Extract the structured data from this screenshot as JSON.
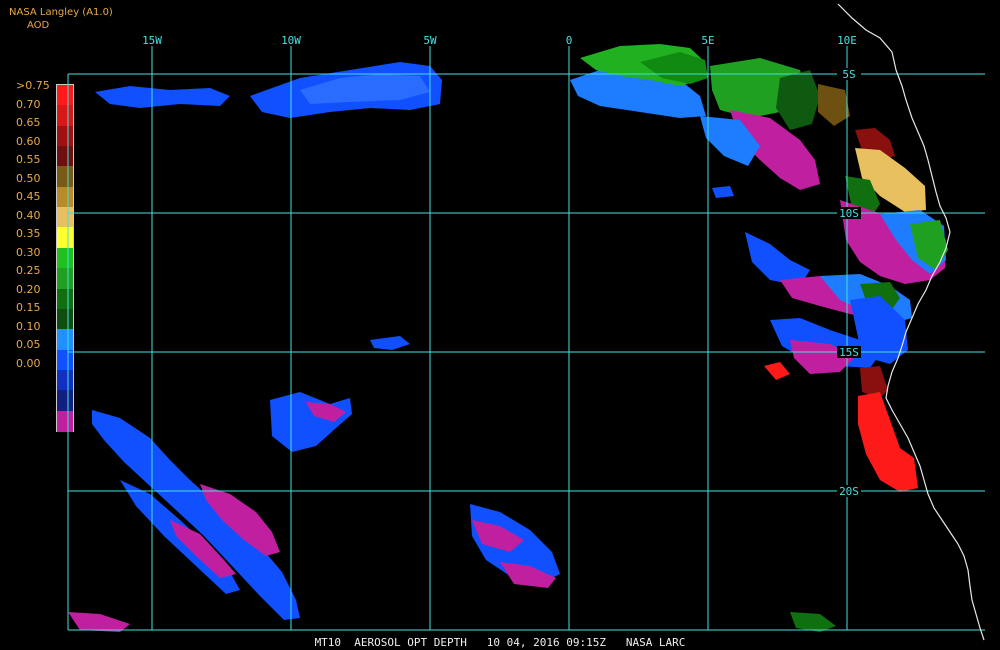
{
  "header": {
    "source": "NASA Langley (A1.0)",
    "product": "AOD"
  },
  "legend": {
    "labels": [
      ">0.75",
      "0.70",
      "0.65",
      "0.60",
      "0.55",
      "0.50",
      "0.45",
      "0.40",
      "0.35",
      "0.30",
      "0.25",
      "0.20",
      "0.15",
      "0.10",
      "0.05",
      "0.00"
    ],
    "colors": [
      "#ff1a1a",
      "#d81818",
      "#a01010",
      "#6e1010",
      "#7a5a14",
      "#b88a2a",
      "#e8c060",
      "#ffff30",
      "#20c020",
      "#20a020",
      "#107010",
      "#104e10",
      "#2090ff",
      "#1050ff",
      "#1030c0",
      "#102080",
      "#c020a0"
    ]
  },
  "grid": {
    "longitudes": [
      "15W",
      "10W",
      "5W",
      "0",
      "5E",
      "10E"
    ],
    "latitudes": [
      "5S",
      "10S",
      "15S",
      "20S"
    ]
  },
  "footer": {
    "caption": "MT10  AEROSOL OPT DEPTH   10 04, 2016 09:15Z   NASA LARC"
  },
  "colors": {
    "label_orange": "#e8a84a",
    "grid_cyan": "#44e0e0",
    "coastline": "#e8e8e8"
  }
}
